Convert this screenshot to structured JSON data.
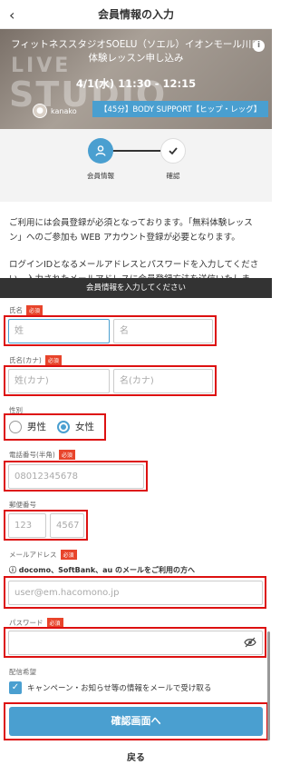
{
  "header": {
    "title": "会員情報の入力",
    "back_icon": "chevron-left-icon"
  },
  "banner": {
    "studio": "フィットネススタジオSOELU（ソエル）イオンモール川口",
    "lesson_type": "体験レッスン申し込み",
    "datetime": "4/1(水) 11:30 - 12:15",
    "instructor": "kanako",
    "lesson_tag": "【45分】BODY SUPPORT【ヒップ・レッグ】",
    "bg_line1": "LIVE",
    "bg_line2": "STUDIO",
    "info_icon": "i"
  },
  "stepper": {
    "steps": [
      {
        "label": "会員情報",
        "icon": "user-icon"
      },
      {
        "label": "確認",
        "icon": "check-icon"
      }
    ]
  },
  "intro": {
    "p1": "ご利用には会員登録が必須となっております。「無料体験レッスン」へのご参加も WEB アカウント登録が必要となります。",
    "p2": "ログインIDとなるメールアドレスとパスワードを入力してください。入力されたメールアドレスに会員登録方法を送信いたします。"
  },
  "form": {
    "section_title": "会員情報を入力してください",
    "required": "必須",
    "name": {
      "label": "氏名",
      "last_placeholder": "姓",
      "first_placeholder": "名"
    },
    "kana": {
      "label": "氏名(カナ)",
      "last_placeholder": "姓(カナ)",
      "first_placeholder": "名(カナ)"
    },
    "gender": {
      "label": "性別",
      "options": [
        "男性",
        "女性"
      ],
      "selected": "女性"
    },
    "phone": {
      "label": "電話番号(半角)",
      "placeholder": "08012345678"
    },
    "postal": {
      "label": "郵便番号",
      "part1": "123",
      "part2": "4567"
    },
    "email": {
      "label": "メールアドレス",
      "note": "ⓘ docomo、SoftBank、au のメールをご利用の方へ",
      "placeholder": "user@em.hacomono.jp"
    },
    "password": {
      "label": "パスワード",
      "toggle_icon": "eye-off-icon"
    },
    "newsletter": {
      "label": "配信希望",
      "checkbox_label": "キャンペーン・お知らせ等の情報をメールで受け取る",
      "checked": true
    },
    "submit_label": "確認画面へ",
    "back_label": "戻る"
  },
  "colors": {
    "accent": "#4a9fd0",
    "required": "#e8442b",
    "highlight": "#d11111",
    "section_bar": "#333333"
  }
}
